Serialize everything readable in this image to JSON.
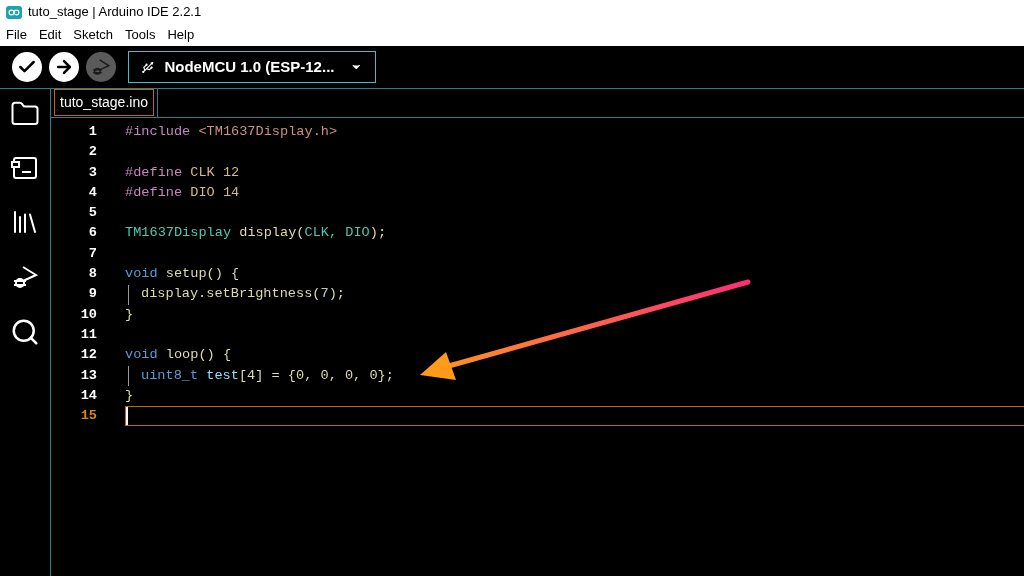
{
  "window": {
    "title": "tuto_stage | Arduino IDE 2.2.1"
  },
  "menu": [
    "File",
    "Edit",
    "Sketch",
    "Tools",
    "Help"
  ],
  "toolbar": {
    "buttons": [
      {
        "kind": "verify",
        "disabled": false
      },
      {
        "kind": "upload",
        "disabled": false
      },
      {
        "kind": "debug",
        "disabled": true
      }
    ],
    "board": "NodeMCU 1.0 (ESP-12..."
  },
  "sidebar": {
    "items": [
      {
        "kind": "folder"
      },
      {
        "kind": "board"
      },
      {
        "kind": "library"
      },
      {
        "kind": "debug"
      },
      {
        "kind": "search"
      }
    ]
  },
  "tabs": [
    {
      "label": "tuto_stage.ino",
      "selected": true
    }
  ],
  "editor": {
    "lines": [
      {
        "number": "1",
        "indented": false,
        "current": false,
        "tokens": [
          {
            "text": "#include ",
            "color": "#c586c0"
          },
          {
            "text": "<TM1637Display.h>",
            "color": "#ce9178"
          }
        ]
      },
      {
        "number": "2",
        "indented": false,
        "current": false
      },
      {
        "number": "3",
        "indented": false,
        "current": false,
        "tokens": [
          {
            "text": "#define ",
            "color": "#c586c0"
          },
          {
            "text": "CLK 12",
            "color": "#d7ba7d"
          }
        ]
      },
      {
        "number": "4",
        "indented": false,
        "current": false,
        "tokens": [
          {
            "text": "#define ",
            "color": "#c586c0"
          },
          {
            "text": "DIO 14",
            "color": "#d7ba7d"
          }
        ]
      },
      {
        "number": "5",
        "indented": false,
        "current": false
      },
      {
        "number": "6",
        "indented": false,
        "current": false,
        "tokens": [
          {
            "text": "TM1637Display ",
            "color": "#4ec9b0"
          },
          {
            "text": "display(",
            "color": "#dcdcaa"
          },
          {
            "text": "CLK, DIO",
            "color": "#4ec9b0"
          },
          {
            "text": ");",
            "color": "#dcdcaa"
          }
        ]
      },
      {
        "number": "7",
        "indented": false,
        "current": false
      },
      {
        "number": "8",
        "indented": false,
        "current": false,
        "tokens": [
          {
            "text": "void ",
            "color": "#569cd6"
          },
          {
            "text": "setup() {",
            "color": "#dcdcaa"
          }
        ]
      },
      {
        "number": "9",
        "indented": true,
        "current": false,
        "tokens": [
          {
            "text": "display.setBrightness(",
            "color": "#dcdcaa"
          },
          {
            "text": "7",
            "color": "#b5cea8"
          },
          {
            "text": ");",
            "color": "#dcdcaa"
          }
        ]
      },
      {
        "number": "10",
        "indented": false,
        "current": false,
        "tokens": [
          {
            "text": "}",
            "color": "#dcdcaa"
          }
        ]
      },
      {
        "number": "11",
        "indented": false,
        "current": false
      },
      {
        "number": "12",
        "indented": false,
        "current": false,
        "tokens": [
          {
            "text": "void ",
            "color": "#569cd6"
          },
          {
            "text": "loop() {",
            "color": "#dcdcaa"
          }
        ]
      },
      {
        "number": "13",
        "indented": true,
        "current": false,
        "tokens": [
          {
            "text": "uint8_t ",
            "color": "#569cd6"
          },
          {
            "text": "test",
            "color": "#9cdcfe"
          },
          {
            "text": "[4] = {0, 0, 0, 0};",
            "color": "#dcdcaa"
          }
        ]
      },
      {
        "number": "14",
        "indented": false,
        "current": false,
        "tokens": [
          {
            "text": "}",
            "color": "#dcdcaa"
          }
        ]
      },
      {
        "number": "15",
        "indented": false,
        "current": true
      }
    ]
  }
}
